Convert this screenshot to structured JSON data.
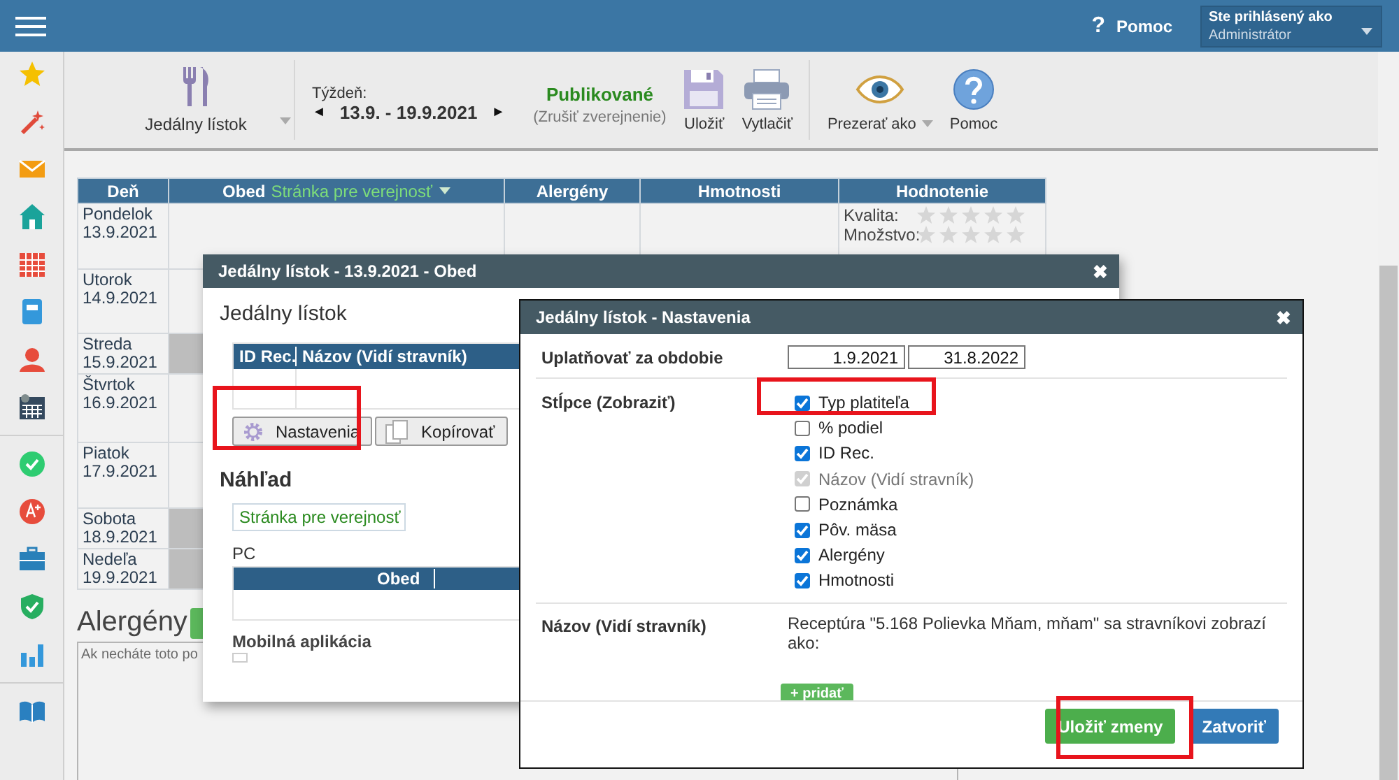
{
  "header": {
    "help_icon": "?",
    "help": "Pomoc",
    "user_label": "Ste prihlásený ako",
    "user": "Administrátor"
  },
  "toolbar": {
    "menu": "Jedálny lístok",
    "week_label": "Týždeň:",
    "prev": "◄",
    "week": "13.9. - 19.9.2021",
    "next": "►",
    "status": "Publikované",
    "unpublish": "(Zrušiť zverejnenie)",
    "buttons": [
      {
        "kind": "save",
        "label": "Uložiť"
      },
      {
        "kind": "print",
        "label": "Vytlačiť"
      },
      {
        "kind": "view",
        "label": "Prezerať ako"
      },
      {
        "kind": "help",
        "label": "Pomoc"
      }
    ]
  },
  "table": {
    "columns": [
      "Deň",
      "Obed",
      "Alergény",
      "Hmotnosti",
      "Hodnotenie"
    ],
    "obed_view": "Stránka pre verejnosť",
    "rows": [
      {
        "day": "Pondelok",
        "date": "13.9.2021",
        "closed": false,
        "rating": [
          {
            "label": "Kvalita:",
            "stars": 0
          },
          {
            "label": "Množstvo:",
            "stars": 0
          }
        ]
      },
      {
        "day": "Utorok",
        "date": "14.9.2021",
        "closed": false
      },
      {
        "day": "Streda",
        "date": "15.9.2021",
        "closed": true
      },
      {
        "day": "Štvrtok",
        "date": "16.9.2021",
        "closed": false
      },
      {
        "day": "Piatok",
        "date": "17.9.2021",
        "closed": false
      },
      {
        "day": "Sobota",
        "date": "18.9.2021",
        "closed": true
      },
      {
        "day": "Nedeľa",
        "date": "19.9.2021",
        "closed": true
      }
    ]
  },
  "allergens": {
    "heading": "Alergény",
    "placeholder": "Ak necháte toto po"
  },
  "dish_dialog": {
    "title": "Jedálny lístok - 13.9.2021 - Obed",
    "close": "✖",
    "section": "Jedálny lístok",
    "columns": [
      "ID Rec.",
      "Názov (Vidí stravník)"
    ],
    "buttons": [
      {
        "kind": "settings",
        "label": "Nastavenia"
      },
      {
        "kind": "copy",
        "label": "Kopírovať"
      }
    ],
    "preview_heading": "Náhľad",
    "preview_select": "Stránka pre verejnosť",
    "pc_label": "PC",
    "pc_column": "Obed",
    "mobile_label": "Mobilná aplikácia",
    "mobile_checked": false
  },
  "settings_dialog": {
    "title": "Jedálny lístok - Nastavenia",
    "close": "✖",
    "period_label": "Uplatňovať za obdobie",
    "period_from": "1.9.2021",
    "period_to": "31.8.2022",
    "columns_label": "Stĺpce (Zobraziť)",
    "columns": [
      {
        "label": "Typ platiteľa",
        "checked": true,
        "disabled": false
      },
      {
        "label": "% podiel",
        "checked": false,
        "disabled": false
      },
      {
        "label": "ID Rec.",
        "checked": true,
        "disabled": false
      },
      {
        "label": "Názov (Vidí stravník)",
        "checked": true,
        "disabled": true
      },
      {
        "label": "Poznámka",
        "checked": false,
        "disabled": false
      },
      {
        "label": "Pôv. mäsa",
        "checked": true,
        "disabled": false
      },
      {
        "label": "Alergény",
        "checked": true,
        "disabled": false
      },
      {
        "label": "Hmotnosti",
        "checked": true,
        "disabled": false
      }
    ],
    "name_label": "Názov (Vidí stravník)",
    "name_text": "Receptúra \"5.168 Polievka Mňam, mňam\" sa stravníkovi zobrazí ako:",
    "add_button": "+ pridať",
    "buttons": [
      {
        "kind": "primary",
        "label": "Uložiť zmeny"
      },
      {
        "kind": "secondary",
        "label": "Zatvoriť"
      }
    ]
  }
}
